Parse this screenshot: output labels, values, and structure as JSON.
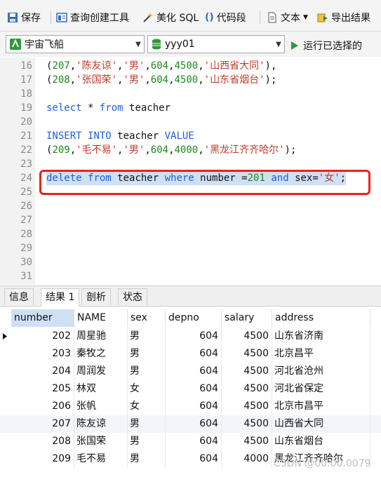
{
  "toolbar": {
    "save": "保存",
    "query_builder": "查询创建工具",
    "beautify": "美化 SQL",
    "snippet": "代码段",
    "text": "文本",
    "export": "导出结果"
  },
  "connection": {
    "value": "宇宙飞船"
  },
  "database": {
    "value": "yyy01"
  },
  "run_selected": "运行已选择的",
  "editor": {
    "lines": [
      {
        "n": "16",
        "code": "(207,'陈友谅','男',604,4500,'山西省大同'),"
      },
      {
        "n": "17",
        "code": "(208,'张国荣','男',604,4500,'山东省烟台');"
      },
      {
        "n": "18",
        "code": ""
      },
      {
        "n": "19",
        "code": "select * from teacher"
      },
      {
        "n": "20",
        "code": ""
      },
      {
        "n": "21",
        "code": "INSERT INTO teacher VALUE"
      },
      {
        "n": "22",
        "code": "(209,'毛不易','男',604,4000,'黑龙江齐齐哈尔');"
      },
      {
        "n": "23",
        "code": ""
      },
      {
        "n": "24",
        "code": "delete from teacher where number =201 and sex='女';"
      },
      {
        "n": "25",
        "code": ""
      },
      {
        "n": "26",
        "code": ""
      },
      {
        "n": "27",
        "code": ""
      },
      {
        "n": "28",
        "code": ""
      },
      {
        "n": "29",
        "code": ""
      },
      {
        "n": "30",
        "code": ""
      },
      {
        "n": "31",
        "code": ""
      }
    ]
  },
  "result_tabs": [
    "信息",
    "结果 1",
    "剖析",
    "状态"
  ],
  "grid": {
    "columns": [
      "number",
      "NAME",
      "sex",
      "depno",
      "salary",
      "address"
    ],
    "rows": [
      [
        "202",
        "周星驰",
        "男",
        "604",
        "4500",
        "山东省济南"
      ],
      [
        "203",
        "秦牧之",
        "男",
        "604",
        "4500",
        "北京昌平"
      ],
      [
        "204",
        "周润发",
        "男",
        "604",
        "4500",
        "河北省沧州"
      ],
      [
        "205",
        "林双",
        "女",
        "604",
        "4500",
        "河北省保定"
      ],
      [
        "206",
        "张帆",
        "女",
        "604",
        "4500",
        "北京市昌平"
      ],
      [
        "207",
        "陈友谅",
        "男",
        "604",
        "4500",
        "山西省大同"
      ],
      [
        "208",
        "张国荣",
        "男",
        "604",
        "4500",
        "山东省烟台"
      ],
      [
        "209",
        "毛不易",
        "男",
        "604",
        "4000",
        "黑龙江齐齐哈尔"
      ]
    ]
  },
  "watermark": "CSDN @00.00.0079"
}
